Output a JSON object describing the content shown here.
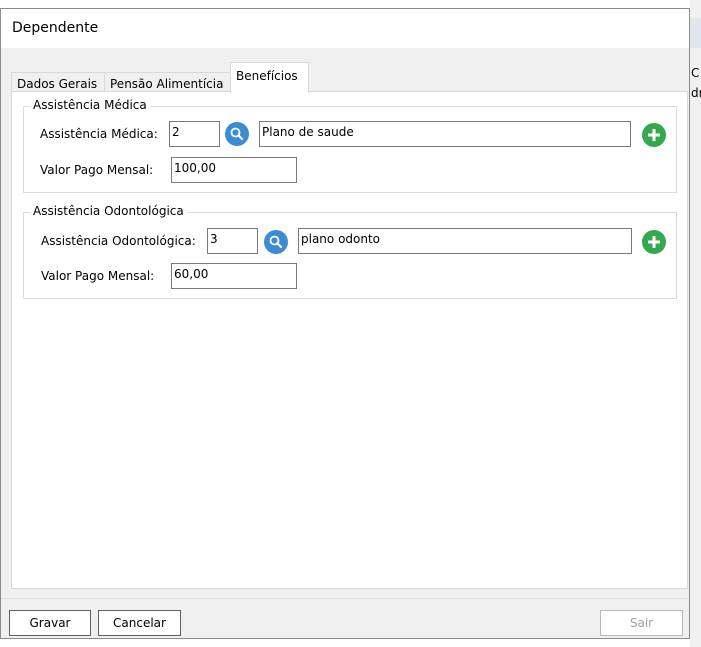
{
  "window": {
    "title": "Dependente"
  },
  "background": {
    "frag1": "C",
    "frag2": "dr"
  },
  "tabs": [
    {
      "label": "Dados Gerais",
      "active": false
    },
    {
      "label": "Pensão Alimentícia",
      "active": false
    },
    {
      "label": "Benefícios",
      "active": true
    }
  ],
  "medica": {
    "legend": "Assistência Médica",
    "field_label": "Assistência Médica:",
    "code": "2",
    "name": "Plano de saude",
    "valor_label": "Valor Pago Mensal:",
    "valor": "100,00"
  },
  "odonto": {
    "legend": "Assistência Odontológica",
    "field_label": "Assistência Odontológica:",
    "code": "3",
    "name": "plano odonto",
    "valor_label": "Valor Pago Mensal:",
    "valor": "60,00"
  },
  "buttons": {
    "gravar": "Gravar",
    "cancelar": "Cancelar",
    "sair": "Sair"
  },
  "colors": {
    "search": "#3d8bd2",
    "add": "#34a84c"
  }
}
